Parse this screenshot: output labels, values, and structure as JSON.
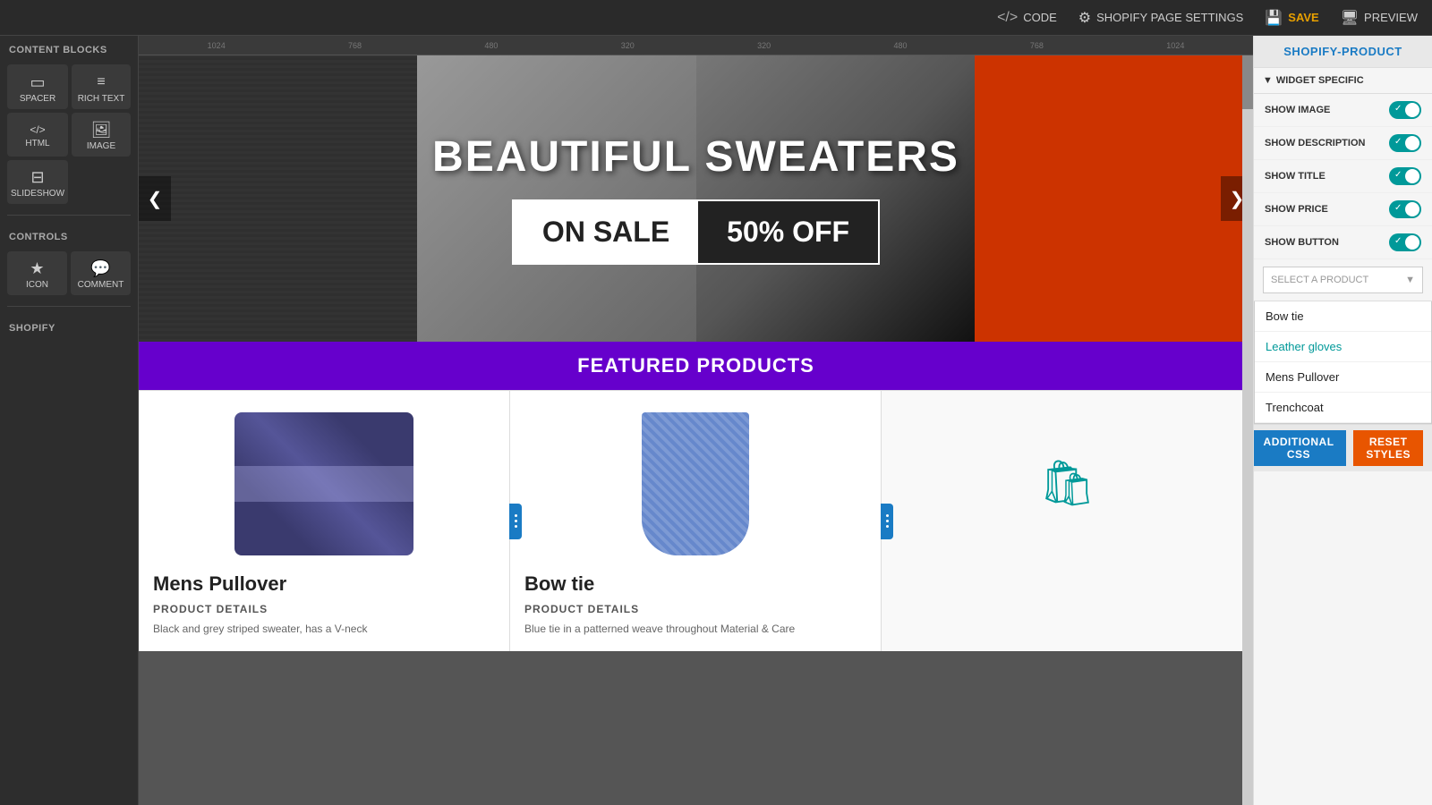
{
  "topbar": {
    "code_label": "CODE",
    "settings_label": "SHOPIFY PAGE SETTINGS",
    "save_label": "SAVE",
    "preview_label": "PREVIEW"
  },
  "left_sidebar": {
    "section_title": "CONTENT BLOCKS",
    "blocks": [
      {
        "id": "spacer",
        "label": "SPACER",
        "icon": "▭"
      },
      {
        "id": "rich-text",
        "label": "RICH TEXT",
        "icon": "≡"
      },
      {
        "id": "html",
        "label": "HTML",
        "icon": "</>"
      },
      {
        "id": "image",
        "label": "IMAGE",
        "icon": "🖼"
      },
      {
        "id": "slideshow",
        "label": "SLIDESHOW",
        "icon": "⊟"
      }
    ],
    "controls_title": "CONTROLS",
    "control_blocks": [
      {
        "id": "icon",
        "label": "ICON",
        "icon": "★"
      },
      {
        "id": "comment",
        "label": "COMMENT",
        "icon": "💬"
      }
    ],
    "shopify_title": "SHOPIFY"
  },
  "ruler": {
    "marks_left": [
      "1024",
      "768",
      "480",
      "320"
    ],
    "marks_right": [
      "320",
      "480",
      "768",
      "1024"
    ]
  },
  "hero": {
    "title": "BEAUTIFUL SWEATERS",
    "sale_left": "ON SALE",
    "sale_right": "50% OFF"
  },
  "featured_bar": {
    "label": "FEATURED PRODUCTS"
  },
  "products": [
    {
      "name": "Mens Pullover",
      "details_label": "PRODUCT DETAILS",
      "desc": "Black and grey striped sweater, has a V-neck"
    },
    {
      "name": "Bow tie",
      "details_label": "PRODUCT DETAILS",
      "desc": "Blue tie in a patterned weave throughout Material & Care"
    },
    {
      "name": "",
      "details_label": "",
      "desc": ""
    }
  ],
  "right_sidebar": {
    "header": "SHOPIFY-PRODUCT",
    "widget_specific": "WIDGET SPECIFIC",
    "toggles": [
      {
        "label": "SHOW IMAGE",
        "on": true
      },
      {
        "label": "SHOW DESCRIPTION",
        "on": true
      },
      {
        "label": "SHOW TITLE",
        "on": true
      },
      {
        "label": "SHOW PRICE",
        "on": true
      },
      {
        "label": "SHOW BUTTON",
        "on": true
      }
    ],
    "select_placeholder": "SELECT A PRODUCT",
    "dropdown_items": [
      {
        "label": "Bow tie",
        "active": false
      },
      {
        "label": "Leather gloves",
        "active": true
      },
      {
        "label": "Mens Pullover",
        "active": false
      },
      {
        "label": "Trenchcoat",
        "active": false
      }
    ]
  },
  "bottom_bar": {
    "additional_css_label": "ADDITIONAL CSS",
    "reset_styles_label": "RESET STYLES"
  }
}
